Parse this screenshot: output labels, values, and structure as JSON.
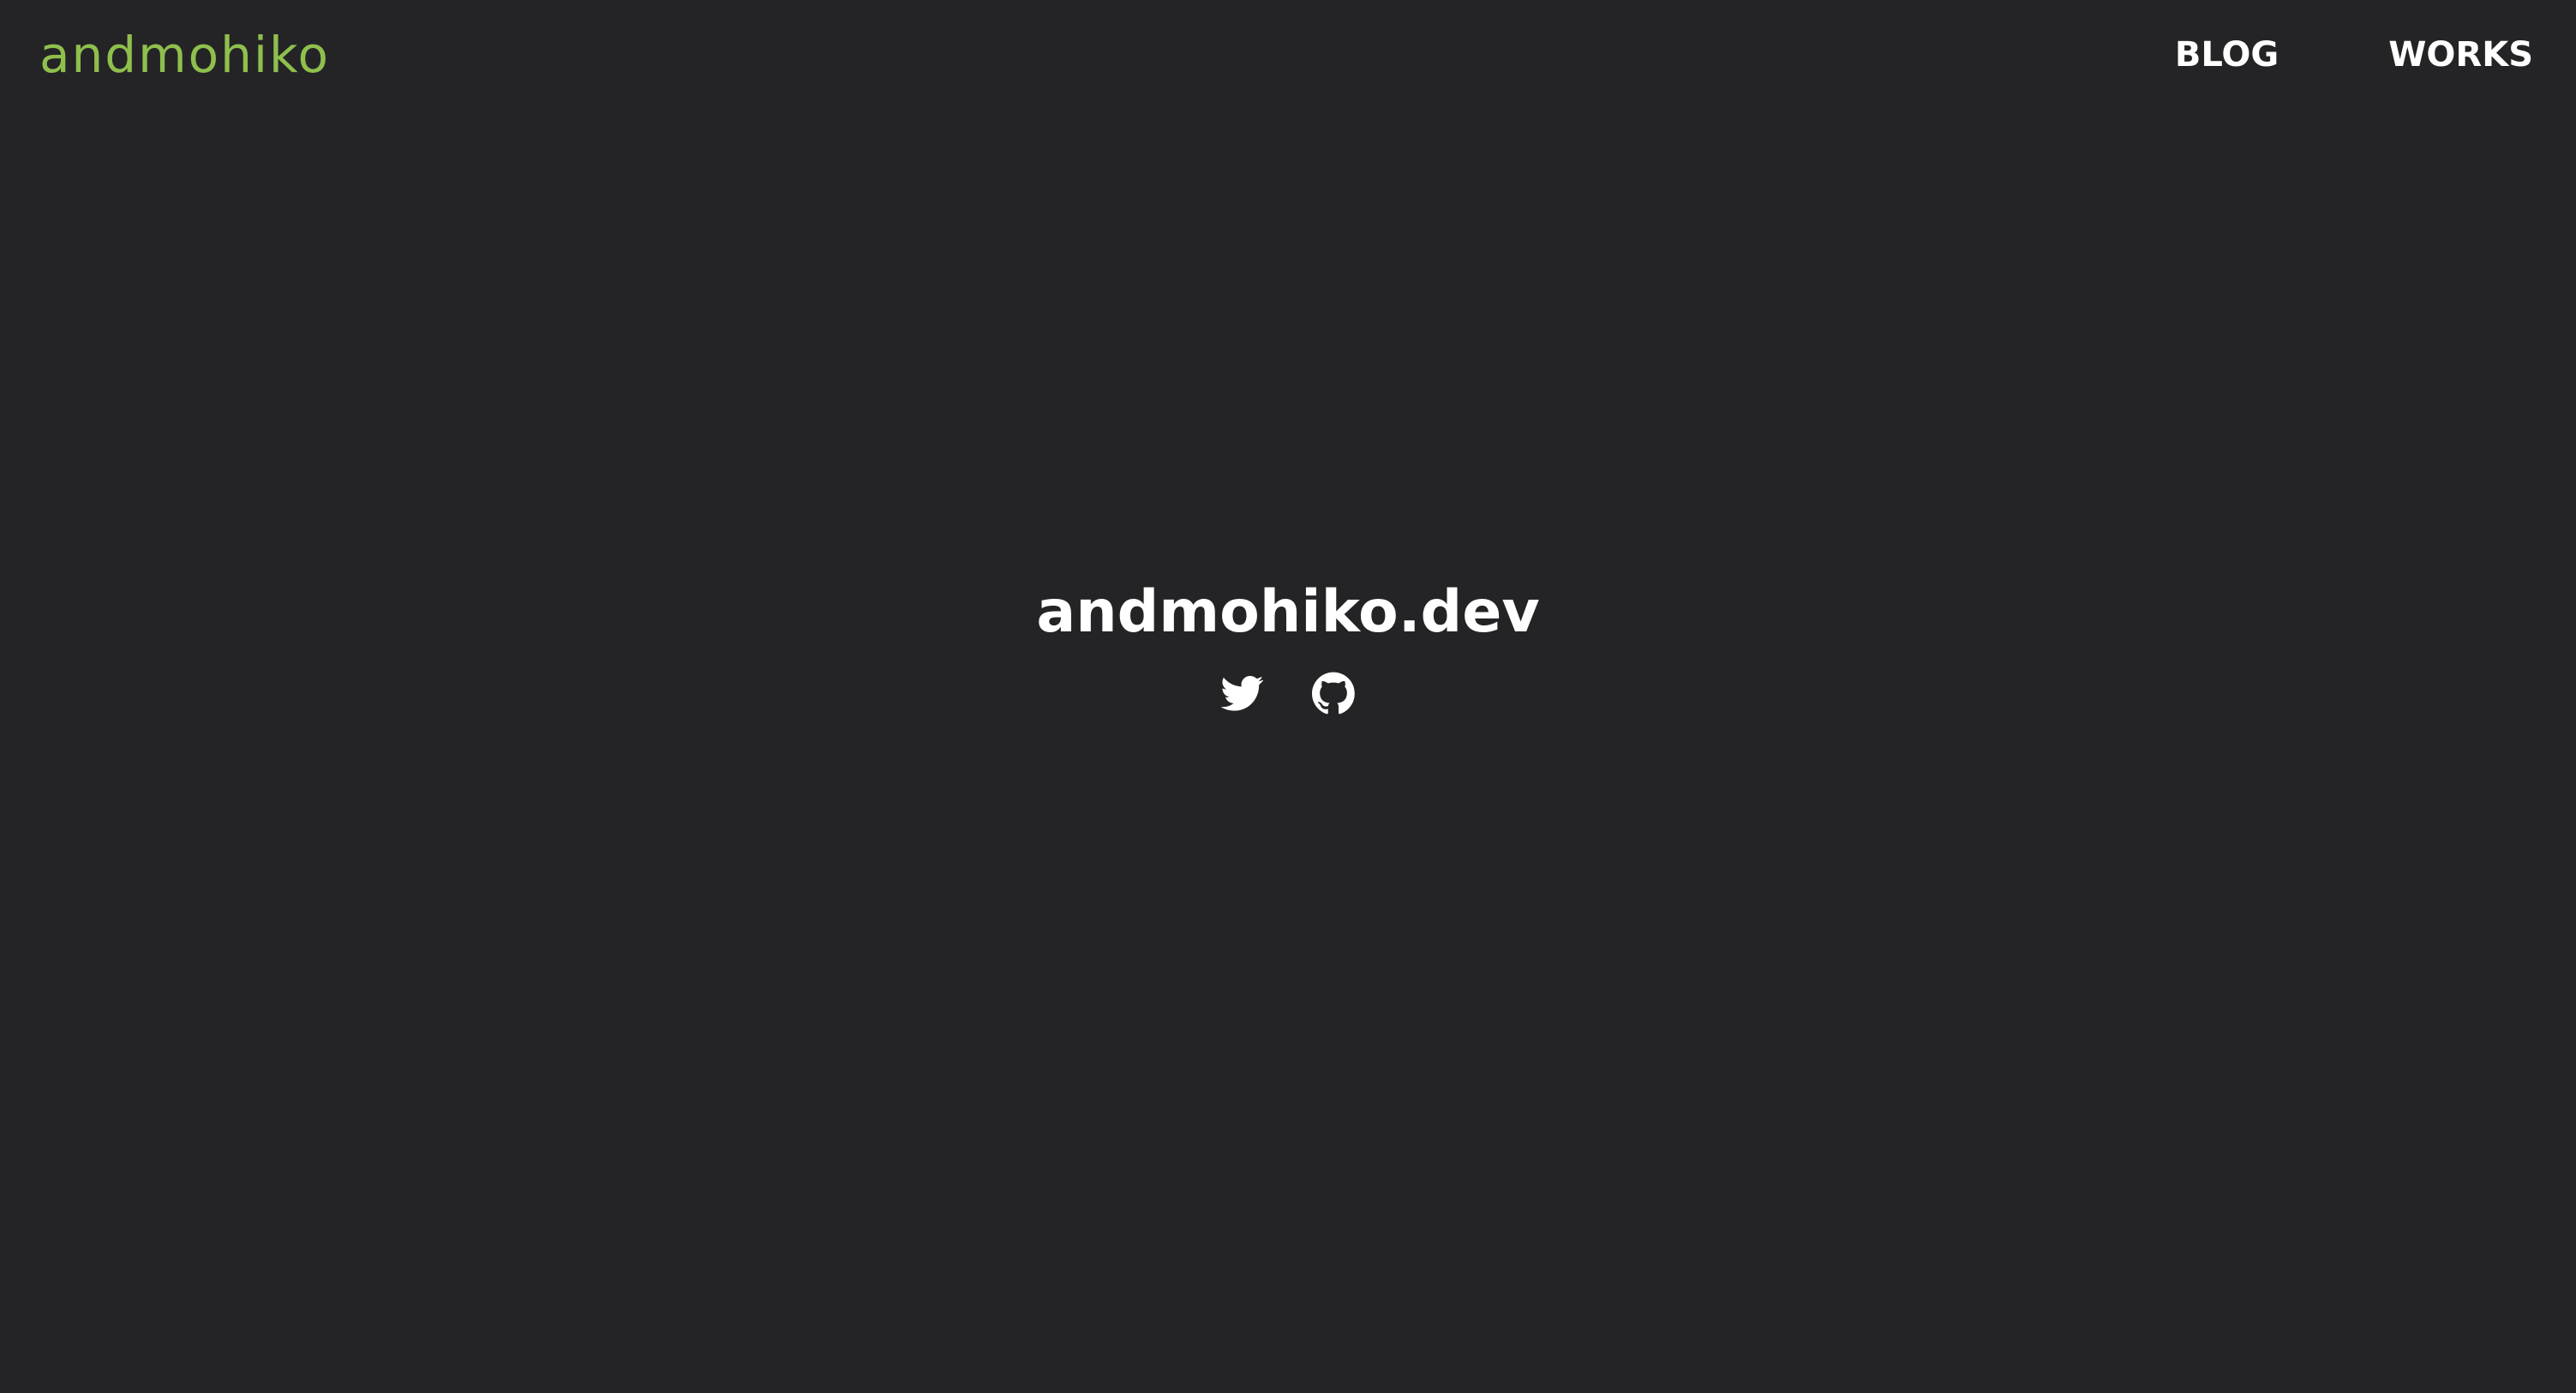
{
  "header": {
    "logo_text": "andmohiko",
    "logo_color": "#8fbf4d",
    "nav": [
      {
        "label": "BLOG"
      },
      {
        "label": "WORKS"
      }
    ]
  },
  "hero": {
    "title": "andmohiko.dev",
    "socials": [
      {
        "icon": "twitter-icon"
      },
      {
        "icon": "github-icon"
      }
    ]
  },
  "colors": {
    "background": "#242426",
    "text": "#ffffff",
    "accent": "#8fbf4d"
  }
}
